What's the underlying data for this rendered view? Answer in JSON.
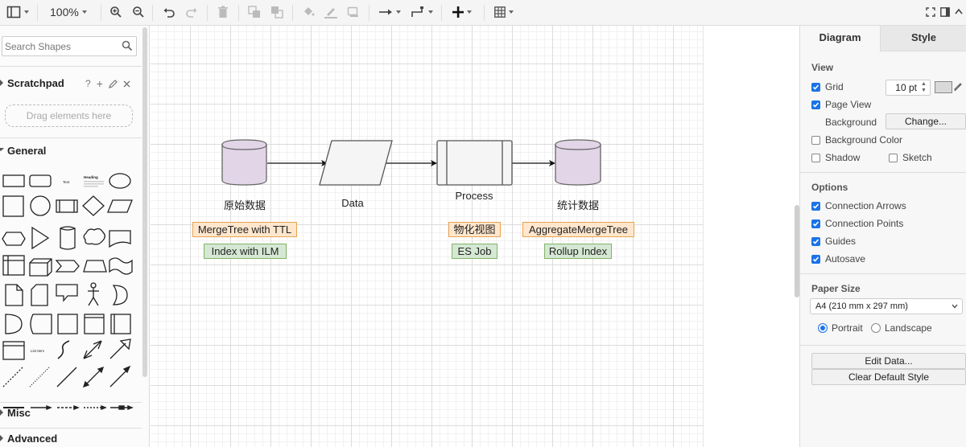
{
  "toolbar": {
    "zoom": "100%",
    "colors": {
      "icon": "#444444",
      "disabled": "#bbbbbb"
    }
  },
  "left_panel": {
    "search_placeholder": "Search Shapes",
    "scratchpad": {
      "title": "Scratchpad",
      "help": "?",
      "add": "+",
      "drop_hint": "Drag elements here"
    },
    "sections": {
      "general": "General",
      "misc": "Misc",
      "advanced": "Advanced"
    },
    "shape_previews": {
      "text": "Text",
      "heading": "Heading",
      "list_item": "List Item"
    }
  },
  "diagram": {
    "nodes": [
      {
        "id": "source",
        "shape": "cylinder",
        "label": "原始数据",
        "fill": "#e1d5e7",
        "stroke": "#666666"
      },
      {
        "id": "data",
        "shape": "parallelogram",
        "label": "Data",
        "fill": "#f5f5f5",
        "stroke": "#555555"
      },
      {
        "id": "process",
        "shape": "process",
        "label": "Process",
        "fill": "#f5f5f5",
        "stroke": "#555555"
      },
      {
        "id": "stats",
        "shape": "cylinder",
        "label": "统计数据",
        "fill": "#e1d5e7",
        "stroke": "#666666"
      }
    ],
    "tags": {
      "source_orange": "MergeTree with TTL",
      "source_green": "Index with ILM",
      "process_orange": "物化视图",
      "process_green": "ES Job",
      "stats_orange": "AggregateMergeTree",
      "stats_green": "Rollup Index"
    },
    "tag_colors": {
      "orange_fill": "#ffe6cc",
      "orange_stroke": "#e8a34f",
      "green_fill": "#d5e8d4",
      "green_stroke": "#82b366"
    }
  },
  "right_panel": {
    "tabs": [
      "Diagram",
      "Style"
    ],
    "view": {
      "title": "View",
      "grid": {
        "label": "Grid",
        "checked": true,
        "size": "10 pt"
      },
      "page_view": {
        "label": "Page View",
        "checked": true
      },
      "background": {
        "label": "Background",
        "button": "Change..."
      },
      "background_color": {
        "label": "Background Color",
        "checked": false
      },
      "shadow": {
        "label": "Shadow",
        "checked": false
      },
      "sketch": {
        "label": "Sketch",
        "checked": false
      }
    },
    "options": {
      "title": "Options",
      "items": [
        {
          "label": "Connection Arrows",
          "checked": true
        },
        {
          "label": "Connection Points",
          "checked": true
        },
        {
          "label": "Guides",
          "checked": true
        },
        {
          "label": "Autosave",
          "checked": true
        }
      ]
    },
    "paper": {
      "title": "Paper Size",
      "size": "A4 (210 mm x 297 mm)",
      "portrait": "Portrait",
      "landscape": "Landscape",
      "orientation": "portrait"
    },
    "buttons": {
      "edit_data": "Edit Data...",
      "clear_style": "Clear Default Style"
    },
    "accent": "#1a73e8"
  }
}
